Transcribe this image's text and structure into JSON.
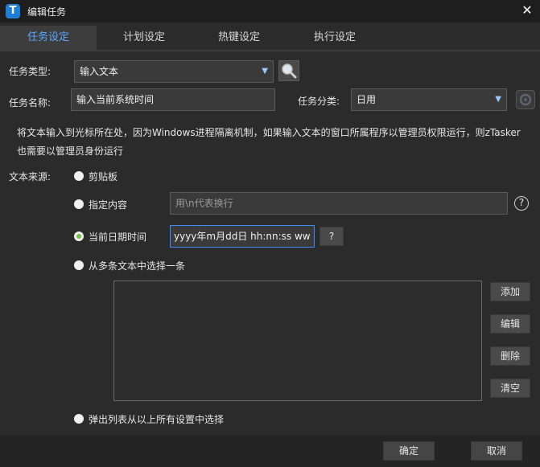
{
  "window": {
    "title": "编辑任务",
    "app_icon": "T",
    "close": "✕"
  },
  "tabs": [
    {
      "label": "任务设定",
      "active": true
    },
    {
      "label": "计划设定",
      "active": false
    },
    {
      "label": "热键设定",
      "active": false
    },
    {
      "label": "执行设定",
      "active": false
    }
  ],
  "form": {
    "task_type_label": "任务类型:",
    "task_type_value": "输入文本",
    "task_name_label": "任务名称:",
    "task_name_value": "输入当前系统时间",
    "task_category_label": "任务分类:",
    "task_category_value": "日用",
    "description_line1": "将文本输入到光标所在处，因为Windows进程隔离机制，如果输入文本的窗口所属程序以管理员权限运行，则zTasker",
    "description_line2": "也需要以管理员身份运行",
    "source_label": "文本来源:",
    "options": {
      "clipboard": "剪贴板",
      "specified": "指定内容",
      "specified_placeholder": "用\\n代表换行",
      "datetime": "当前日期时间",
      "datetime_value": "yyyy年m月dd日 hh:nn:ss ww",
      "datetime_help": "?",
      "multi": "从多条文本中选择一条",
      "popup": "弹出列表从以上所有设置中选择"
    },
    "selected_option": "datetime",
    "help_icon_text": "?"
  },
  "list_buttons": {
    "add": "添加",
    "edit": "编辑",
    "delete": "删除",
    "clear": "清空"
  },
  "footer": {
    "ok": "确定",
    "cancel": "取消"
  },
  "colors": {
    "accent": "#5aa9ff",
    "radio_selected": "#7ac143",
    "background": "#2b2b2b"
  }
}
